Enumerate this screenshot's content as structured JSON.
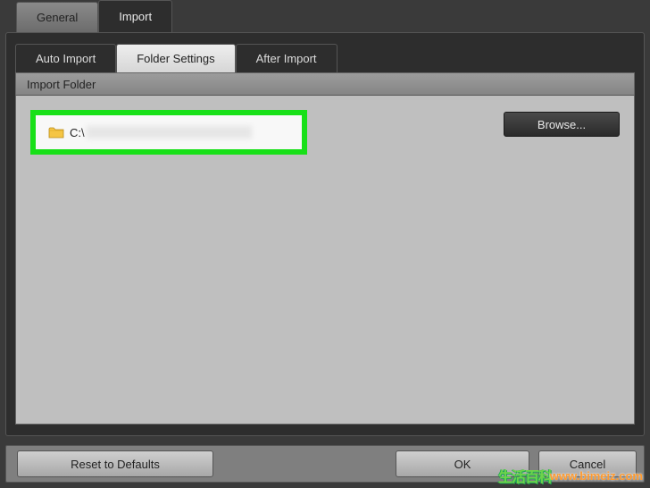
{
  "top_tabs": {
    "general": "General",
    "import": "Import"
  },
  "sub_tabs": {
    "auto_import": "Auto Import",
    "folder_settings": "Folder Settings",
    "after_import": "After Import"
  },
  "section": {
    "header": "Import Folder"
  },
  "folder": {
    "path_prefix": "C:\\"
  },
  "buttons": {
    "browse": "Browse...",
    "reset": "Reset to Defaults",
    "ok": "OK",
    "cancel": "Cancel"
  },
  "watermark": {
    "badge": "生活百科",
    "url": "www.bimeiz.com"
  }
}
